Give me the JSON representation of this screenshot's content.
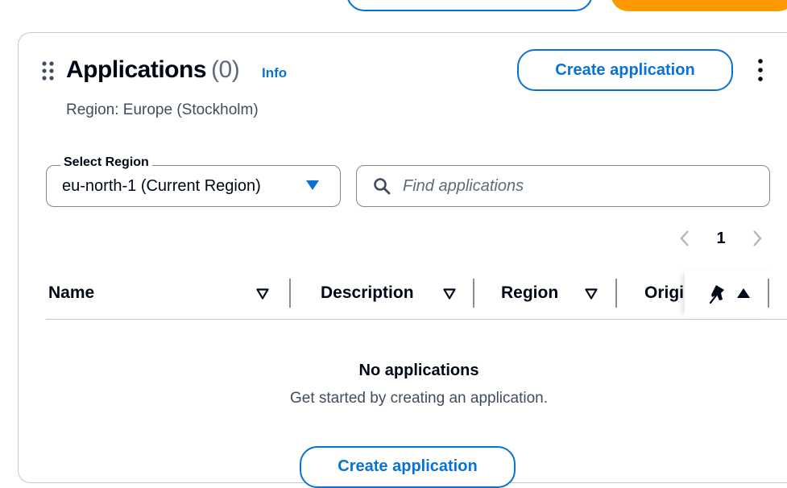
{
  "panel": {
    "title": "Applications",
    "count": "(0)",
    "info_label": "Info",
    "region_desc": "Region: Europe (Stockholm)",
    "create_button_label": "Create application"
  },
  "region_select": {
    "label": "Select Region",
    "value": "eu-north-1 (Current Region)"
  },
  "search": {
    "placeholder": "Find applications"
  },
  "pagination": {
    "current_page": "1"
  },
  "table": {
    "columns": [
      {
        "label": "Name"
      },
      {
        "label": "Description"
      },
      {
        "label": "Region"
      },
      {
        "label": "Origin"
      }
    ]
  },
  "empty_state": {
    "title": "No applications",
    "description": "Get started by creating an application.",
    "button_label": "Create application"
  },
  "colors": {
    "accent": "#0972d3",
    "orange": "#ff9900",
    "border": "#c6c6cd",
    "text": "#000716",
    "muted": "#414d5c"
  },
  "icons": [
    "drag-handle-icon",
    "kebab-menu-icon",
    "caret-down-icon",
    "search-icon",
    "chevron-left-icon",
    "chevron-right-icon",
    "sort-icon",
    "pin-icon",
    "sort-up-icon"
  ]
}
